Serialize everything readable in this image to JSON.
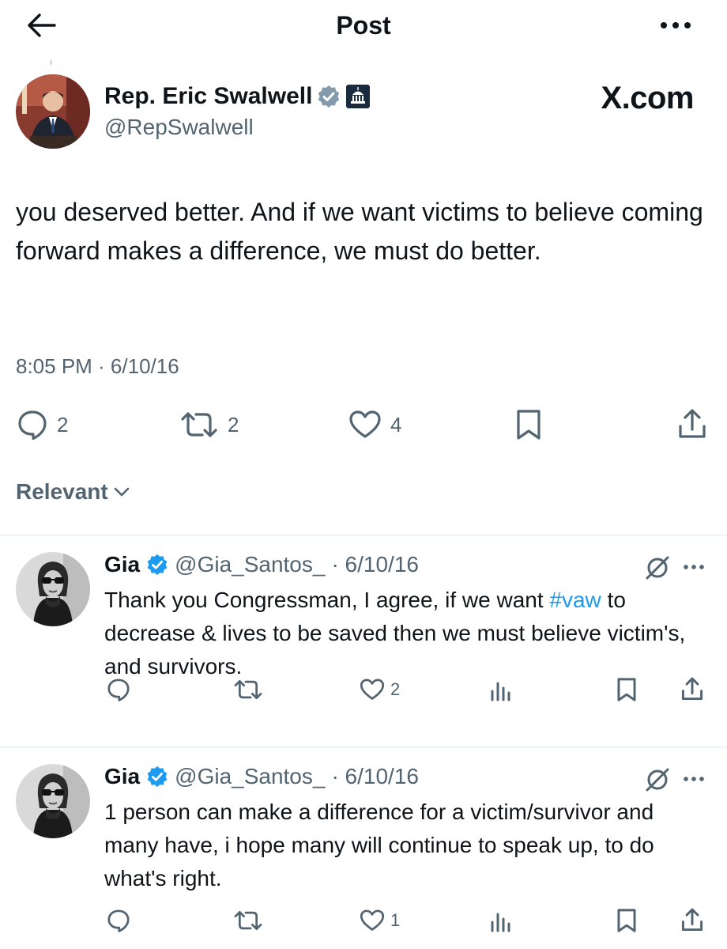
{
  "header": {
    "title": "Post",
    "back_icon": "arrow-left-icon",
    "more_icon": "more-horizontal-icon"
  },
  "post": {
    "author_name": "Rep. Eric Swalwell",
    "author_handle": "@RepSwalwell",
    "source_label": "X.com",
    "text": "you deserved better. And if we want victims to believe coming forward makes a difference, we must do better.",
    "timestamp": "8:05 PM · 6/10/16",
    "reply_count": "2",
    "repost_count": "2",
    "like_count": "4"
  },
  "sort": {
    "label": "Relevant"
  },
  "replies": [
    {
      "name": "Gia",
      "handle": "@Gia_Santos_",
      "date": "· 6/10/16",
      "text_before": "Thank you Congressman, I agree, if we want ",
      "hashtag": "#vaw",
      "text_after": " to decrease & lives to be saved then we must believe victim's, and survivors.",
      "like_count": "2"
    },
    {
      "name": "Gia",
      "handle": "@Gia_Santos_",
      "date": "· 6/10/16",
      "text": "1 person can make a difference for a victim/survivor and many have, i hope many will continue to speak up, to do what's right.",
      "like_count": "1"
    }
  ],
  "colors": {
    "verified": "#1d9bf0",
    "secondary_text": "#536471",
    "hashtag": "#1d9bf0"
  }
}
